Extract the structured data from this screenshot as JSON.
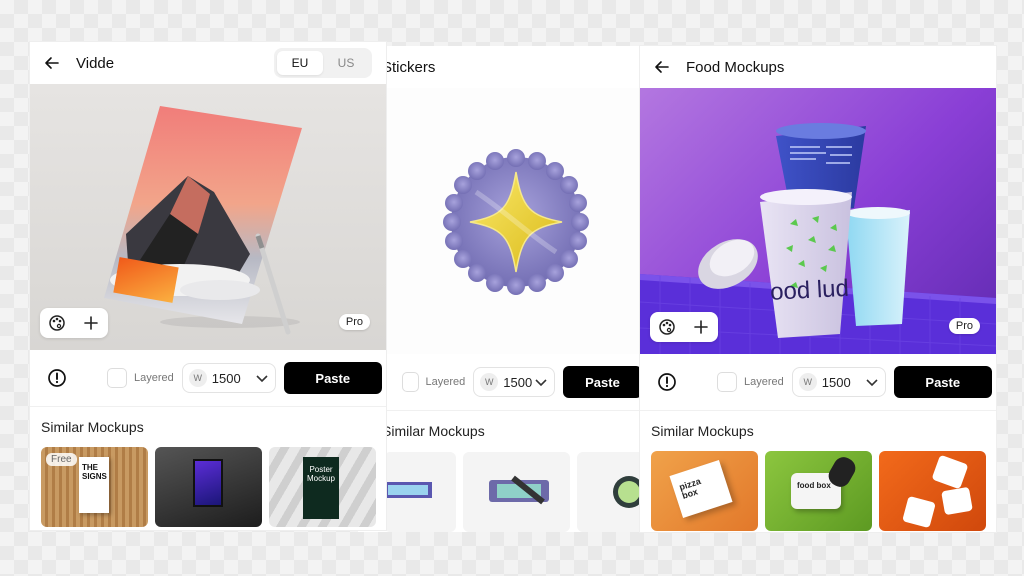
{
  "panel_left": {
    "title": "Vidde",
    "region_options": [
      "EU",
      "US"
    ],
    "selected_region": "EU",
    "badge": "Pro",
    "layered_label": "Layered",
    "width_badge": "W",
    "width_value": "1500",
    "paste_label": "Paste",
    "similar_title": "Similar Mockups",
    "thumb_free_label": "Free",
    "thumb_sign_text": "THE SIGNS",
    "thumb_poster_text": "Poster Mockup"
  },
  "panel_middle": {
    "title": "Stickers",
    "layered_label": "Layered",
    "width_badge": "W",
    "width_value": "1500",
    "paste_label": "Paste",
    "similar_title": "Similar Mockups"
  },
  "panel_right": {
    "title": "Food Mockups",
    "badge": "Pro",
    "cup_text": "ood lud",
    "layered_label": "Layered",
    "width_badge": "W",
    "width_value": "1500",
    "paste_label": "Paste",
    "similar_title": "Similar Mockups",
    "thumb_pizza_text": "pizza box",
    "thumb_food_text": "food box"
  },
  "colors": {
    "paste_button": "#000000",
    "food_background": "#8a3fd6",
    "sticker_fill": "#8c86c9",
    "star": "#f1d53c"
  }
}
